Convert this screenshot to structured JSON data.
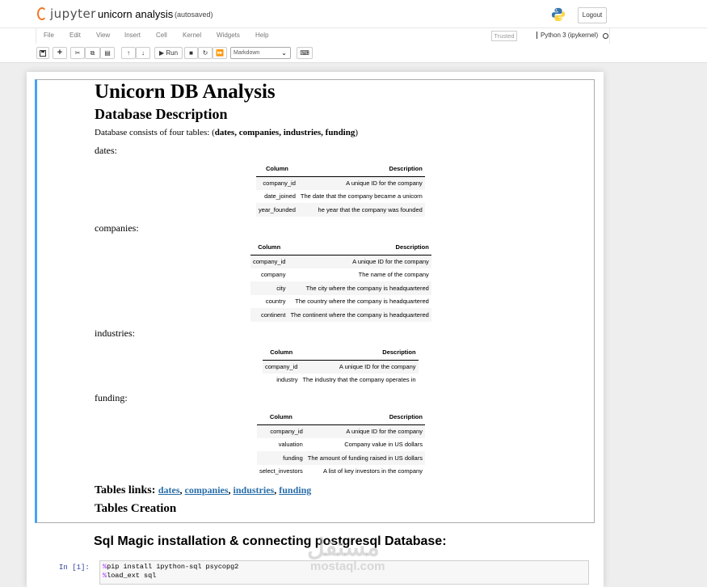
{
  "header": {
    "logo_text": "jupyter",
    "notebook_name": "unicorn analysis",
    "autosave_status": "(autosaved)",
    "logout_label": "Logout",
    "brand_color": "#f37726"
  },
  "menubar": {
    "items": [
      "File",
      "Edit",
      "View",
      "Insert",
      "Cell",
      "Kernel",
      "Widgets",
      "Help"
    ],
    "trusted_label": "Trusted",
    "kernel_name": "Python 3 (ipykernel)"
  },
  "toolbar": {
    "run_label": "Run",
    "cell_type": "Markdown",
    "buttons": [
      "save-icon",
      "plus-icon",
      "cut-icon",
      "copy-icon",
      "paste-icon",
      "arrow-up-icon",
      "arrow-down-icon",
      "run-icon",
      "stop-icon",
      "restart-icon",
      "fast-forward-icon",
      "keyboard-icon"
    ]
  },
  "markdown": {
    "title": "Unicorn DB Analysis",
    "subtitle": "Database Description",
    "intro_prefix": "Database consists of four tables: (",
    "intro_tables": "dates, companies, industries, funding",
    "intro_suffix": ")",
    "tables": [
      {
        "name": "dates:",
        "columns": [
          "Column",
          "Description"
        ],
        "rows": [
          [
            "company_id",
            "A unique ID for the company"
          ],
          [
            "date_joined",
            "The date that the company became a unicorn"
          ],
          [
            "year_founded",
            "he year that the company was founded"
          ]
        ]
      },
      {
        "name": "companies:",
        "columns": [
          "Column",
          "Description"
        ],
        "rows": [
          [
            "company_id",
            "A unique ID for the company"
          ],
          [
            "company",
            "The name of the company"
          ],
          [
            "city",
            "The city where the company is headquartered"
          ],
          [
            "country",
            "The country where the company is headquartered"
          ],
          [
            "continent",
            "The continent where the company is headquartered"
          ]
        ]
      },
      {
        "name": "industries:",
        "columns": [
          "Column",
          "Description"
        ],
        "rows": [
          [
            "company_id",
            "A unique ID for the company"
          ],
          [
            "industry",
            "The industry that the company operates in"
          ]
        ]
      },
      {
        "name": "funding:",
        "columns": [
          "Column",
          "Description"
        ],
        "rows": [
          [
            "company_id",
            "A unique ID for the company"
          ],
          [
            "valuation",
            "Company value in US dollars"
          ],
          [
            "funding",
            "The amount of funding raised in US dollars"
          ],
          [
            "select_investors",
            "A list of key investors in the company"
          ]
        ]
      }
    ],
    "links_label": "Tables links:",
    "links": [
      "dates",
      "companies",
      "industries",
      "funding"
    ],
    "section_heading": "Tables Creation",
    "link_color": "#296eaa"
  },
  "next_markdown": {
    "heading": "Sql Magic installation & connecting postgresql Database:"
  },
  "code_cell": {
    "prompt": "In [1]:",
    "line1_magic": "%",
    "line1_rest": "pip install ipython-sql psycopg2",
    "line2_magic": "%",
    "line2_rest": "load_ext sql"
  },
  "watermark": {
    "arabic": "مستقل",
    "latin": "mostaql.com"
  }
}
